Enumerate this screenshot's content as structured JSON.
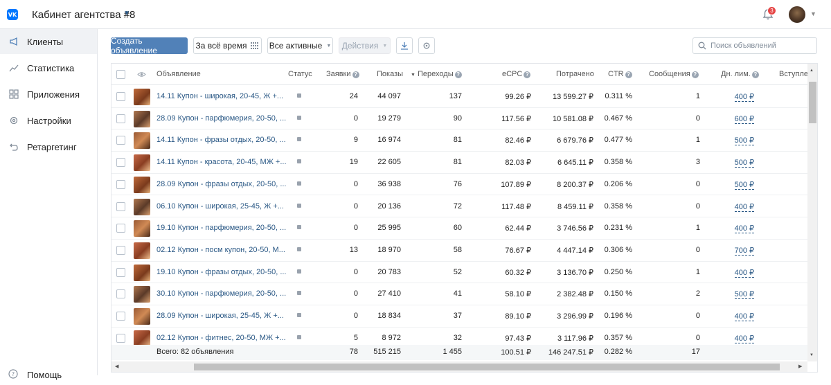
{
  "header": {
    "logo_text": "VK",
    "cabinet_title": "Кабинет агентства #8",
    "notifications_count": "3"
  },
  "sidebar": {
    "items": [
      {
        "label": "Клиенты",
        "icon": "megaphone-icon",
        "active": true
      },
      {
        "label": "Статистика",
        "icon": "chart-line-icon",
        "active": false
      },
      {
        "label": "Приложения",
        "icon": "apps-grid-icon",
        "active": false
      },
      {
        "label": "Настройки",
        "icon": "gear-icon",
        "active": false
      },
      {
        "label": "Ретаргетинг",
        "icon": "retarget-arrow-icon",
        "active": false
      }
    ],
    "help_label": "Помощь"
  },
  "toolbar": {
    "create_label": "Создать объявление",
    "period_label": "За всё время",
    "filter_label": "Все активные",
    "actions_label": "Действия",
    "search_placeholder": "Поиск объявлений"
  },
  "table": {
    "columns": {
      "ad": "Объявление",
      "status": "Статус",
      "leads": "Заявки",
      "impressions": "Показы",
      "clicks": "Переходы",
      "ecpc": "eCPC",
      "spent": "Потрачено",
      "ctr": "CTR",
      "messages": "Сообщения",
      "daily_limit": "Дн. лим.",
      "joined": "Вступлен"
    },
    "rows": [
      {
        "name": "14.11 Купон - широкая, 20-45, Ж +...",
        "leads": "24",
        "impressions": "44 097",
        "clicks": "137",
        "ecpc": "99.26 ₽",
        "spent": "13 599.27 ₽",
        "ctr": "0.311 %",
        "messages": "1",
        "limit": "400 ₽"
      },
      {
        "name": "28.09 Купон - парфюмерия, 20-50, ...",
        "leads": "0",
        "impressions": "19 279",
        "clicks": "90",
        "ecpc": "117.56 ₽",
        "spent": "10 581.08 ₽",
        "ctr": "0.467 %",
        "messages": "0",
        "limit": "600 ₽"
      },
      {
        "name": "14.11 Купон - фразы отдых, 20-50, ...",
        "leads": "9",
        "impressions": "16 974",
        "clicks": "81",
        "ecpc": "82.46 ₽",
        "spent": "6 679.76 ₽",
        "ctr": "0.477 %",
        "messages": "1",
        "limit": "500 ₽"
      },
      {
        "name": "14.11 Купон - красота, 20-45, МЖ +...",
        "leads": "19",
        "impressions": "22 605",
        "clicks": "81",
        "ecpc": "82.03 ₽",
        "spent": "6 645.11 ₽",
        "ctr": "0.358 %",
        "messages": "3",
        "limit": "500 ₽"
      },
      {
        "name": "28.09 Купон - фразы отдых, 20-50, ...",
        "leads": "0",
        "impressions": "36 938",
        "clicks": "76",
        "ecpc": "107.89 ₽",
        "spent": "8 200.37 ₽",
        "ctr": "0.206 %",
        "messages": "0",
        "limit": "500 ₽"
      },
      {
        "name": "06.10 Купон - широкая, 25-45, Ж +...",
        "leads": "0",
        "impressions": "20 136",
        "clicks": "72",
        "ecpc": "117.48 ₽",
        "spent": "8 459.11 ₽",
        "ctr": "0.358 %",
        "messages": "0",
        "limit": "400 ₽"
      },
      {
        "name": "19.10 Купон - парфюмерия, 20-50, ...",
        "leads": "0",
        "impressions": "25 995",
        "clicks": "60",
        "ecpc": "62.44 ₽",
        "spent": "3 746.56 ₽",
        "ctr": "0.231 %",
        "messages": "1",
        "limit": "400 ₽"
      },
      {
        "name": "02.12 Купон - посм купон, 20-50, М...",
        "leads": "13",
        "impressions": "18 970",
        "clicks": "58",
        "ecpc": "76.67 ₽",
        "spent": "4 447.14 ₽",
        "ctr": "0.306 %",
        "messages": "0",
        "limit": "700 ₽"
      },
      {
        "name": "19.10 Купон - фразы отдых, 20-50, ...",
        "leads": "0",
        "impressions": "20 783",
        "clicks": "52",
        "ecpc": "60.32 ₽",
        "spent": "3 136.70 ₽",
        "ctr": "0.250 %",
        "messages": "1",
        "limit": "400 ₽"
      },
      {
        "name": "30.10 Купон - парфюмерия, 20-50, ...",
        "leads": "0",
        "impressions": "27 410",
        "clicks": "41",
        "ecpc": "58.10 ₽",
        "spent": "2 382.48 ₽",
        "ctr": "0.150 %",
        "messages": "2",
        "limit": "500 ₽"
      },
      {
        "name": "28.09 Купон - широкая, 25-45, Ж +...",
        "leads": "0",
        "impressions": "18 834",
        "clicks": "37",
        "ecpc": "89.10 ₽",
        "spent": "3 296.99 ₽",
        "ctr": "0.196 %",
        "messages": "0",
        "limit": "400 ₽"
      },
      {
        "name": "02.12 Купон - фитнес, 20-50, МЖ +...",
        "leads": "5",
        "impressions": "8 972",
        "clicks": "32",
        "ecpc": "97.43 ₽",
        "spent": "3 117.96 ₽",
        "ctr": "0.357 %",
        "messages": "0",
        "limit": "400 ₽"
      }
    ],
    "total": {
      "label": "Всего: 82 объявления",
      "leads": "78",
      "impressions": "515 215",
      "clicks": "1 455",
      "ecpc": "100.51 ₽",
      "spent": "146 247.51 ₽",
      "ctr": "0.282 %",
      "messages": "17"
    }
  },
  "colors": {
    "accent": "#5181b8",
    "link": "#2a5885",
    "badge": "#e64646",
    "brand": "#0077ff"
  }
}
